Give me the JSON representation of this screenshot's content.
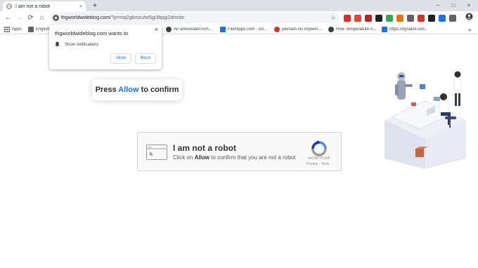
{
  "tab": {
    "title": "I am not a robot",
    "close_glyph": "×",
    "new_tab_glyph": "+"
  },
  "window": {
    "minimize": "−",
    "maximize": "□",
    "close": "×"
  },
  "toolbar": {
    "back": "←",
    "forward": "→",
    "reload": "⟳",
    "home": "⌂"
  },
  "omnibox": {
    "host": "thgworldwideblog.com",
    "path": "/?p=mq2gkmzuhe5gi3bpgi2dmnbr",
    "star": "☆"
  },
  "extensions": [
    "#d93025",
    "#ea4335",
    "#c5221f",
    "#202124",
    "#34a853",
    "#e8710a",
    "#5f6368",
    "#d93025",
    "#202124",
    "#1a73e8",
    "#5f6368"
  ],
  "bookmarks": [
    {
      "label": "Apps",
      "icon": "apps-grid-icon"
    },
    {
      "label": "English",
      "color": "#5f6368"
    },
    {
      "label": "An antioxidant-rich...",
      "color": "#3c4043"
    },
    {
      "label": "FileHippo.com - Do...",
      "color": "#1a73e8"
    },
    {
      "label": "jeemain.nic.in/jeem...",
      "color": "#d93025"
    },
    {
      "label": "How Temperature A...",
      "color": "#3c4043"
    },
    {
      "label": "https://dynalist.io/d...",
      "color": "#1a73e8"
    }
  ],
  "bookmarks_more": "»",
  "notification": {
    "site_text": "thgworldwideblog.com wants to",
    "permission": "Show notifications",
    "allow": "Allow",
    "block": "Block",
    "close": "×"
  },
  "press_box": {
    "prefix": "Press ",
    "highlight": "Allow",
    "suffix": " to confirm"
  },
  "robot_box": {
    "heading": "I am not a robot",
    "sub_prefix": "Click on ",
    "sub_bold": "Allow",
    "sub_suffix": " to confirm that you are not a robot",
    "recaptcha": "reCAPTCHA",
    "privacy": "Privacy",
    "separator": " - ",
    "terms": "Term"
  }
}
